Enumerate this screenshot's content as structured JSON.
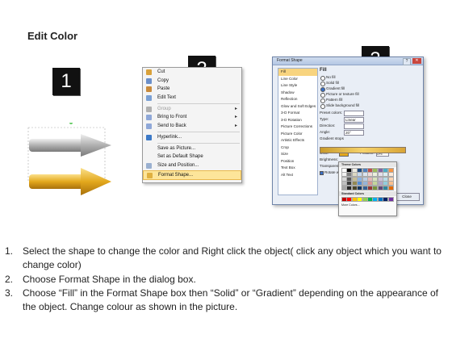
{
  "title": "Edit Color",
  "steps": [
    {
      "badge": "1"
    },
    {
      "badge": "2"
    },
    {
      "badge": "3"
    }
  ],
  "colors": {
    "gray_arrow": "#a9a9a9",
    "gold_arrow": "#e3a81d",
    "menu_highlight": "#fde59a",
    "fill_selected": "#f8d47f"
  },
  "context_menu": {
    "items": [
      {
        "label": "Cut",
        "icon": "scissors-icon",
        "disabled": false,
        "submenu": false
      },
      {
        "label": "Copy",
        "icon": "copy-icon",
        "disabled": false,
        "submenu": false
      },
      {
        "label": "Paste",
        "icon": "paste-icon",
        "disabled": false,
        "submenu": false
      },
      {
        "label": "Edit Text",
        "icon": "edit-text-icon",
        "disabled": false,
        "submenu": false
      },
      {
        "label": "Group",
        "icon": "group-icon",
        "disabled": true,
        "submenu": true
      },
      {
        "label": "Bring to Front",
        "icon": "bring-front-icon",
        "disabled": false,
        "submenu": true
      },
      {
        "label": "Send to Back",
        "icon": "send-back-icon",
        "disabled": false,
        "submenu": true
      },
      {
        "label": "Hyperlink...",
        "icon": "hyperlink-icon",
        "disabled": false,
        "submenu": false
      },
      {
        "label": "Save as Picture...",
        "icon": "",
        "disabled": false,
        "submenu": false
      },
      {
        "label": "Set as Default Shape",
        "icon": "",
        "disabled": false,
        "submenu": false
      },
      {
        "label": "Size and Position...",
        "icon": "size-icon",
        "disabled": false,
        "submenu": false
      },
      {
        "label": "Format Shape...",
        "icon": "format-shape-icon",
        "disabled": false,
        "submenu": false,
        "highlighted": true
      }
    ]
  },
  "format_dialog": {
    "title": "Format Shape",
    "categories": [
      "Fill",
      "Line Color",
      "Line Style",
      "Shadow",
      "Reflection",
      "Glow and Soft Edges",
      "3-D Format",
      "3-D Rotation",
      "Picture Corrections",
      "Picture Color",
      "Artistic Effects",
      "Crop",
      "Size",
      "Position",
      "Text Box",
      "Alt Text"
    ],
    "selected_category": "Fill",
    "section_title": "Fill",
    "fill_options": [
      {
        "label": "No fill",
        "checked": false
      },
      {
        "label": "Solid fill",
        "checked": false
      },
      {
        "label": "Gradient fill",
        "checked": true
      },
      {
        "label": "Picture or texture fill",
        "checked": false
      },
      {
        "label": "Pattern fill",
        "checked": false
      },
      {
        "label": "Slide background fill",
        "checked": false
      }
    ],
    "fields": [
      {
        "label": "Preset colors:",
        "value": ""
      },
      {
        "label": "Type:",
        "value": "Linear"
      },
      {
        "label": "Direction:",
        "value": ""
      },
      {
        "label": "Angle:",
        "value": "20°"
      }
    ],
    "gradient_label": "Gradient stops",
    "color_label": "Color",
    "position_label": "Position:",
    "position_value": "0%",
    "brightness_label": "Brightness:",
    "transparency_label": "Transparency:",
    "rotate_label": "Rotate with shape",
    "close_label": "Close"
  },
  "palette": {
    "theme_label": "Theme Colors",
    "standard_label": "Standard Colors",
    "more_label": "More Colors...",
    "theme_colors": [
      "#ffffff",
      "#000000",
      "#eeece1",
      "#1f497d",
      "#4f81bd",
      "#c0504d",
      "#9bbb59",
      "#8064a2",
      "#4bacc6",
      "#f79646",
      "#f2f2f2",
      "#7f7f7f",
      "#ddd9c3",
      "#c6d9f0",
      "#dbe5f1",
      "#f2dcdb",
      "#ebf1dd",
      "#e5e0ec",
      "#dbeef3",
      "#fdeada",
      "#d8d8d8",
      "#595959",
      "#c4bd97",
      "#8db3e2",
      "#b8cce4",
      "#e5b9b7",
      "#d7e3bc",
      "#ccc1d9",
      "#b7dde8",
      "#fbd5b5",
      "#bfbfbf",
      "#3f3f3f",
      "#938953",
      "#548dd4",
      "#95b3d7",
      "#d99694",
      "#c3d69b",
      "#b2a2c7",
      "#92cddc",
      "#fac08f",
      "#a5a5a5",
      "#262626",
      "#494429",
      "#17365d",
      "#366092",
      "#953734",
      "#76923c",
      "#5f497a",
      "#31859b",
      "#e36c09"
    ],
    "standard_colors": [
      "#c00000",
      "#ff0000",
      "#ffc000",
      "#ffff00",
      "#92d050",
      "#00b050",
      "#00b0f0",
      "#0070c0",
      "#002060",
      "#7030a0"
    ]
  },
  "instructions": [
    {
      "num": "1.",
      "text": "Select the shape to change the color and Right click the object( click any object which you want to change color)"
    },
    {
      "num": "2.",
      "text": "Choose Format Shape in the dialog box."
    },
    {
      "num": "3.",
      "text": "Choose “Fill” in the Format Shape box then “Solid” or “Gradient” depending on the appearance of the object. Change colour as shown in the picture."
    }
  ]
}
